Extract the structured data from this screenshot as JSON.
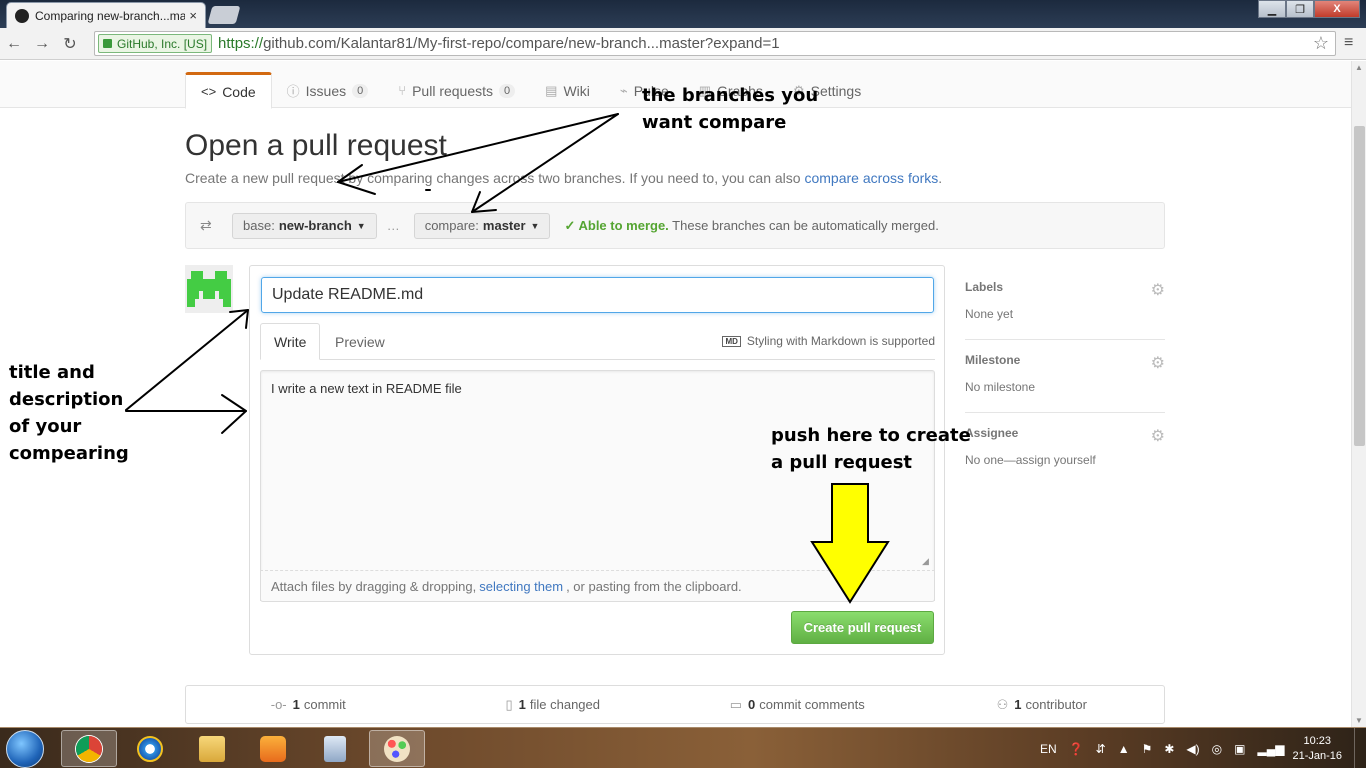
{
  "browser": {
    "tab_title": "Comparing new-branch...master",
    "tab_close": "×",
    "ev_label": "GitHub, Inc. [US]",
    "url_scheme": "https://",
    "url_rest": "github.com/Kalantar81/My-first-repo/compare/new-branch...master?expand=1",
    "back": "←",
    "forward": "→",
    "reload": "↻",
    "star": "☆",
    "menu": "≡",
    "min": "▁",
    "max": "❐",
    "close": "X"
  },
  "reponav": {
    "code": "Code",
    "issues": "Issues",
    "issues_count": "0",
    "pulls": "Pull requests",
    "pulls_count": "0",
    "wiki": "Wiki",
    "pulse": "Pulse",
    "graphs": "Graphs",
    "settings": "Settings"
  },
  "page": {
    "title": "Open a pull request",
    "subtitle": "Create a new pull request by comparing changes across two branches. If you need to, you can also ",
    "subtitle_link": "compare across forks",
    "subtitle_end": "."
  },
  "range": {
    "base_label": "base:",
    "base_value": "new-branch",
    "dots": "…",
    "compare_label": "compare:",
    "compare_value": "master",
    "merge_ok": "✓ Able to merge.",
    "merge_msg": " These branches can be automatically merged."
  },
  "form": {
    "title_value": "Update README.md",
    "tab_write": "Write",
    "tab_preview": "Preview",
    "md_badge": "MD",
    "md_hint": "Styling with Markdown is supported",
    "body_value": "I write a new text in README file",
    "attach_prefix": "Attach files by dragging & dropping,",
    "attach_link": "selecting them",
    "attach_suffix": ", or pasting from the clipboard.",
    "submit": "Create pull request"
  },
  "sidebar": [
    {
      "heading": "Labels",
      "value": "None yet"
    },
    {
      "heading": "Milestone",
      "value": "No milestone"
    },
    {
      "heading": "Assignee",
      "value": "No one—assign yourself"
    }
  ],
  "summary": {
    "commits_count": "1",
    "commits_label": "commit",
    "files_count": "1",
    "files_label": "file changed",
    "comments_count": "0",
    "comments_label": "commit comments",
    "contrib_count": "1",
    "contrib_label": "contributor"
  },
  "annotations": {
    "branches_line1": "the branches you",
    "branches_line2": "want compare",
    "title_line1": "title and",
    "title_line2": "description",
    "title_line3": "of your",
    "title_line4": "compearing",
    "push_line1": "push here to create",
    "push_line2": "a pull request"
  },
  "taskbar": {
    "lang": "EN",
    "time": "10:23",
    "date": "21-Jan-16"
  },
  "colors": {
    "accent_tab": "#d26911",
    "link": "#4078c0",
    "merge_green": "#55a532",
    "button_green": "#60b044",
    "arrow_yellow": "#ffff00"
  }
}
